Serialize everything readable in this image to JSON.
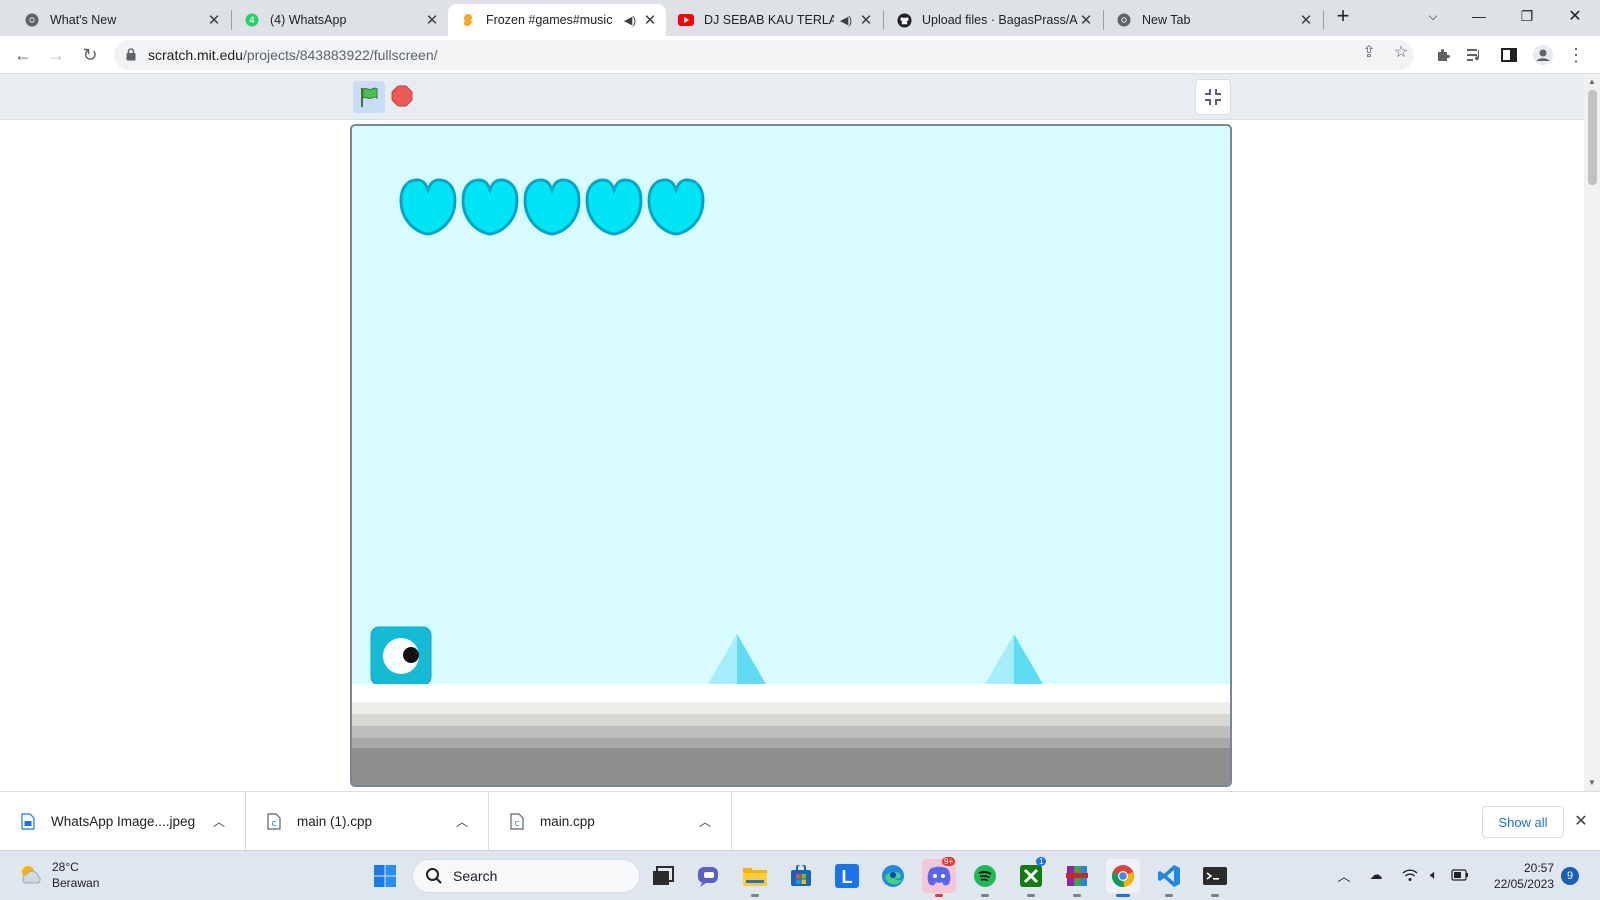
{
  "tabs": [
    {
      "title": "What's New",
      "icon": "chrome-icon",
      "active": false
    },
    {
      "title": "(4) WhatsApp",
      "icon": "whatsapp-icon",
      "active": false
    },
    {
      "title": "Frozen #games#music",
      "icon": "scratch-icon",
      "active": true,
      "muted": true
    },
    {
      "title": "DJ SEBAB KAU TERLALU",
      "icon": "youtube-icon",
      "active": false,
      "muted": true
    },
    {
      "title": "Upload files · BagasPrass/A",
      "icon": "github-icon",
      "active": false
    },
    {
      "title": "New Tab",
      "icon": "chrome-icon",
      "active": false
    }
  ],
  "address": {
    "host": "scratch.mit.edu",
    "path": "/projects/843883922/fullscreen/"
  },
  "stage": {
    "hearts": 5,
    "colors": {
      "sky": "#d8fbff",
      "heart": "#00e5f5",
      "heart_outline": "#00a7c4",
      "player": "#13bcd4",
      "spike": "#93ecfb"
    }
  },
  "downloads": [
    {
      "name": "WhatsApp Image....jpeg",
      "icon": "image-file-icon"
    },
    {
      "name": "main (1).cpp",
      "icon": "cpp-file-icon"
    },
    {
      "name": "main.cpp",
      "icon": "cpp-file-icon"
    }
  ],
  "downloads_show_all": "Show all",
  "taskbar": {
    "weather_temp": "28°C",
    "weather_desc": "Berawan",
    "search_label": "Search",
    "time": "20:57",
    "date": "22/05/2023",
    "notifications": "9",
    "discord_badge": "9+",
    "xbox_badge": "1"
  }
}
